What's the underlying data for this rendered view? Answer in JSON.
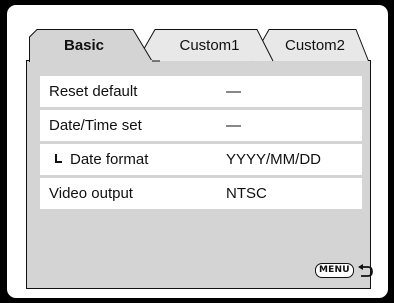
{
  "tabs": [
    {
      "label": "Basic",
      "active": true
    },
    {
      "label": "Custom1",
      "active": false
    },
    {
      "label": "Custom2",
      "active": false
    }
  ],
  "rows": [
    {
      "label": "Reset default",
      "value": "—"
    },
    {
      "label": "Date/Time set",
      "value": "—"
    },
    {
      "label": "Date format",
      "value": "YYYY/MM/DD",
      "sub": true
    },
    {
      "label": "Video output",
      "value": "NTSC"
    }
  ],
  "footer": {
    "menu_label": "MENU",
    "return_icon": "return-arrow-icon"
  },
  "colors": {
    "screen_bg": "#ffffff",
    "panel_bg": "#d4d4d4",
    "row_bg": "#ffffff",
    "text": "#111111",
    "frame": "#000000"
  }
}
